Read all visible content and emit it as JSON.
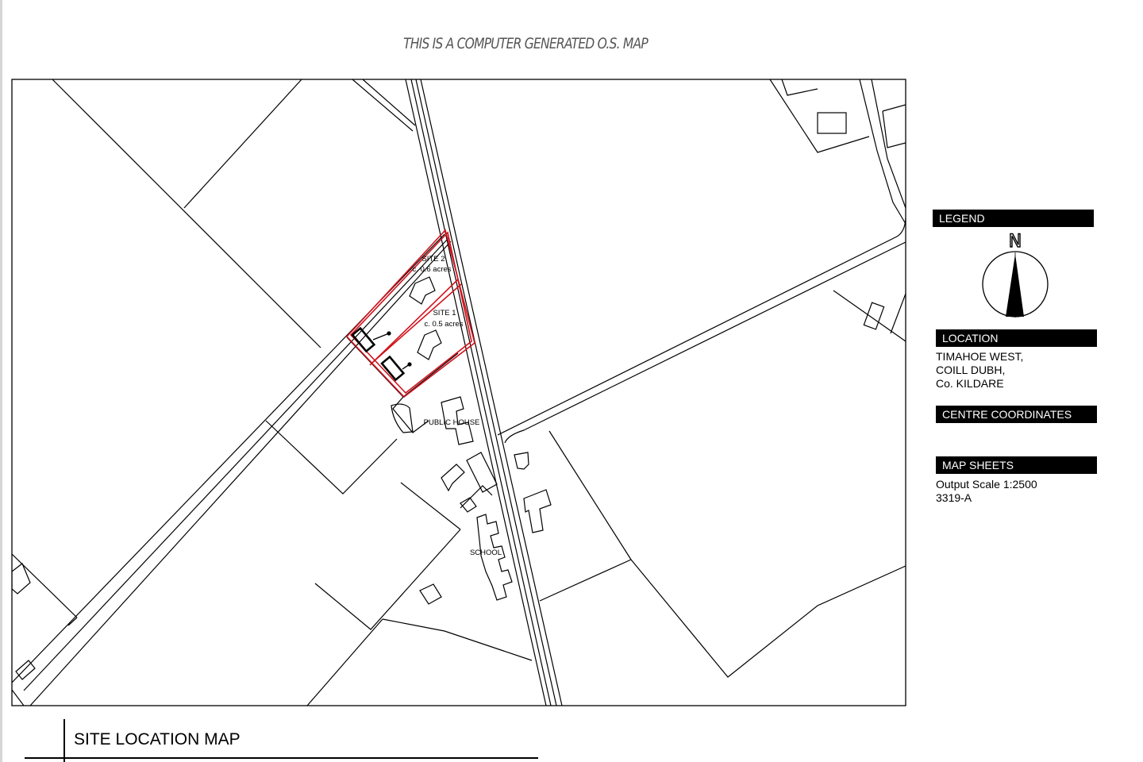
{
  "header": {
    "title": "THIS IS A COMPUTER GENERATED O.S. MAP"
  },
  "map": {
    "labels": {
      "site2_name": "SITE 2",
      "site2_area": "c. 0.6 acres",
      "site1_name": "SITE 1",
      "site1_area": "c. 0.5 acres",
      "public_house": "PUBLIC HOUSE",
      "school": "SCHOOL"
    },
    "colors": {
      "boundary": "#d0141e",
      "linework": "#000000"
    }
  },
  "legend": {
    "heading": "LEGEND",
    "north": "N",
    "location_heading": "LOCATION",
    "location_lines": [
      "TIMAHOE WEST,",
      "COILL DUBH,",
      "Co. KILDARE"
    ],
    "coords_heading": "CENTRE COORDINATES",
    "sheets_heading": "MAP SHEETS",
    "sheets_lines": [
      "Output Scale 1:2500",
      "3319-A"
    ]
  },
  "footer": {
    "title": "SITE LOCATION MAP"
  }
}
